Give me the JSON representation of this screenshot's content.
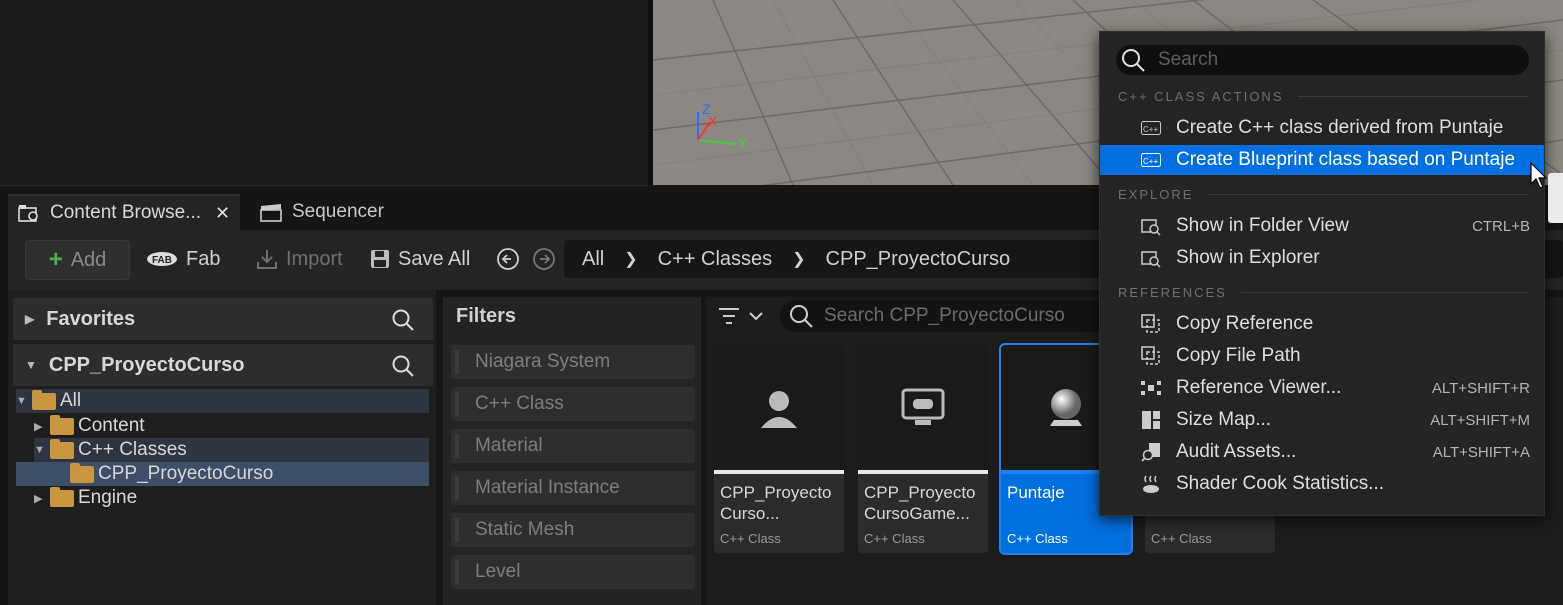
{
  "tabs": [
    {
      "label": "Content Browse...",
      "icon": "content-browser-icon"
    },
    {
      "label": "Sequencer",
      "icon": "clapper-icon"
    }
  ],
  "toolbar": {
    "add_label": "Add",
    "fab_label": "Fab",
    "import_label": "Import",
    "saveall_label": "Save All"
  },
  "breadcrumb": [
    "All",
    "C++ Classes",
    "CPP_ProyectoCurso"
  ],
  "left_panel": {
    "favorites_label": "Favorites",
    "project_label": "CPP_ProyectoCurso",
    "tree": [
      "All",
      "Content",
      "C++ Classes",
      "CPP_ProyectoCurso",
      "Engine"
    ]
  },
  "filters": {
    "title": "Filters",
    "items": [
      "Niagara System",
      "C++ Class",
      "Material",
      "Material Instance",
      "Static Mesh",
      "Level"
    ]
  },
  "asset_search": {
    "placeholder": "Search CPP_ProyectoCurso"
  },
  "assets": [
    {
      "name": "CPP_Proyecto\nCurso...",
      "type": "C++ Class",
      "icon": "character-icon"
    },
    {
      "name": "CPP_Proyecto\nCursoGame...",
      "type": "C++ Class",
      "icon": "game-mode-icon"
    },
    {
      "name": "Puntaje",
      "type": "C++ Class",
      "icon": "actor-sphere-icon",
      "selected": true
    },
    {
      "name": "",
      "type": "C++ Class",
      "icon": ""
    }
  ],
  "context_menu": {
    "search_placeholder": "Search",
    "sections": [
      "C++ CLASS ACTIONS",
      "EXPLORE",
      "REFERENCES"
    ],
    "items": [
      {
        "label": "Create C++ class derived from Puntaje",
        "shortcut": ""
      },
      {
        "label": "Create Blueprint class based on Puntaje",
        "shortcut": "",
        "highlighted": true
      },
      {
        "label": "Show in Folder View",
        "shortcut": "CTRL+B"
      },
      {
        "label": "Show in Explorer",
        "shortcut": ""
      },
      {
        "label": "Copy Reference",
        "shortcut": ""
      },
      {
        "label": "Copy File Path",
        "shortcut": ""
      },
      {
        "label": "Reference Viewer...",
        "shortcut": "ALT+SHIFT+R"
      },
      {
        "label": "Size Map...",
        "shortcut": "ALT+SHIFT+M"
      },
      {
        "label": "Audit Assets...",
        "shortcut": "ALT+SHIFT+A"
      },
      {
        "label": "Shader Cook Statistics...",
        "shortcut": ""
      }
    ]
  },
  "viewport": {
    "axis_labels": [
      "Z",
      "X",
      "Y"
    ]
  },
  "colors": {
    "accent": "#0070e0",
    "folder": "#c8963e"
  }
}
